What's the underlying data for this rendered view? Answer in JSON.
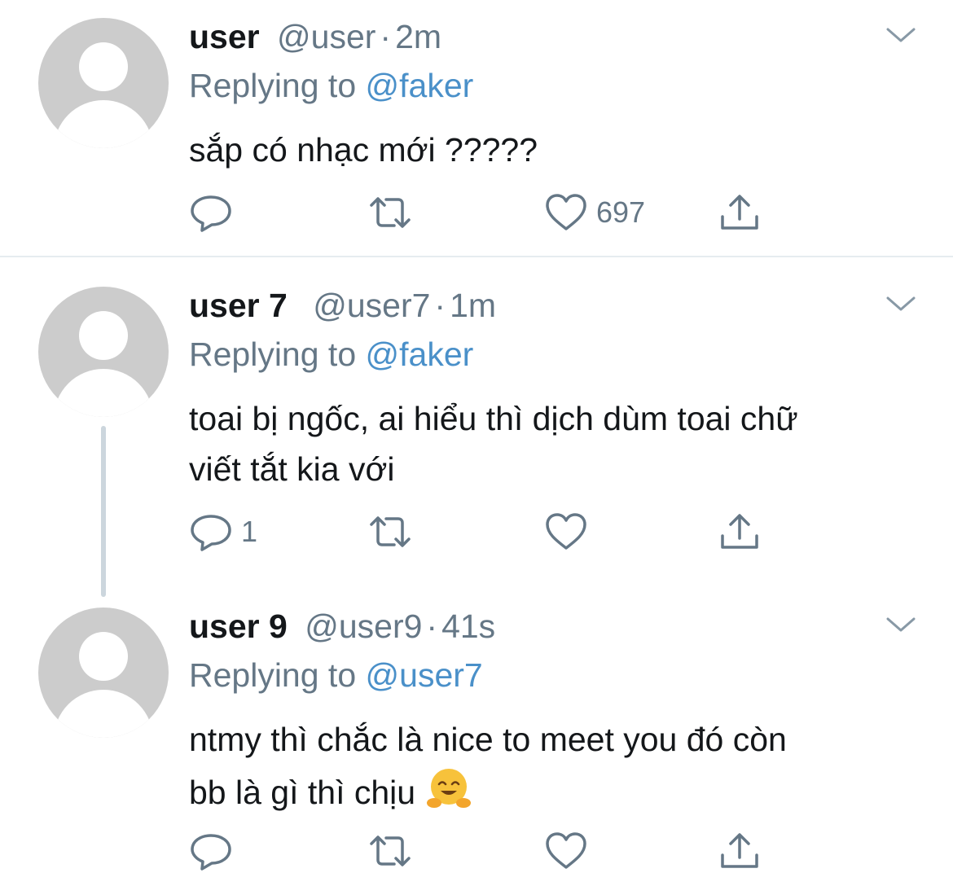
{
  "tweets": [
    {
      "display_name": "user",
      "handle": "@user",
      "separator": "·",
      "time": "2m",
      "replying_prefix": "Replying to",
      "replying_to": "@faker",
      "text": "sắp có nhạc mới ?????",
      "reply_count": "",
      "retweet_count": "",
      "like_count": "697"
    },
    {
      "display_name": "user 7",
      "handle": "@user7",
      "separator": "·",
      "time": "1m",
      "replying_prefix": "Replying to",
      "replying_to": "@faker",
      "text": "toai bị ngốc, ai hiểu thì dịch dùm toai chữ\nviết tắt kia với",
      "reply_count": "1",
      "retweet_count": "",
      "like_count": ""
    },
    {
      "display_name": "user 9",
      "handle": "@user9",
      "separator": "·",
      "time": "41s",
      "replying_prefix": "Replying to",
      "replying_to": "@user7",
      "text": "ntmy thì chắc là nice to meet you đó còn\nbb là gì thì chịu ",
      "emoji": "hugging-face-emoji",
      "reply_count": "",
      "retweet_count": "",
      "like_count": ""
    }
  ],
  "colors": {
    "text": "#14171a",
    "secondary": "#657786",
    "link": "#4a90c9",
    "avatar_bg": "#cccccc",
    "thread_line": "#ccd6dd"
  },
  "icons": {
    "reply": "reply-icon",
    "retweet": "retweet-icon",
    "like": "heart-icon",
    "share": "share-icon",
    "more": "chevron-down-icon"
  }
}
